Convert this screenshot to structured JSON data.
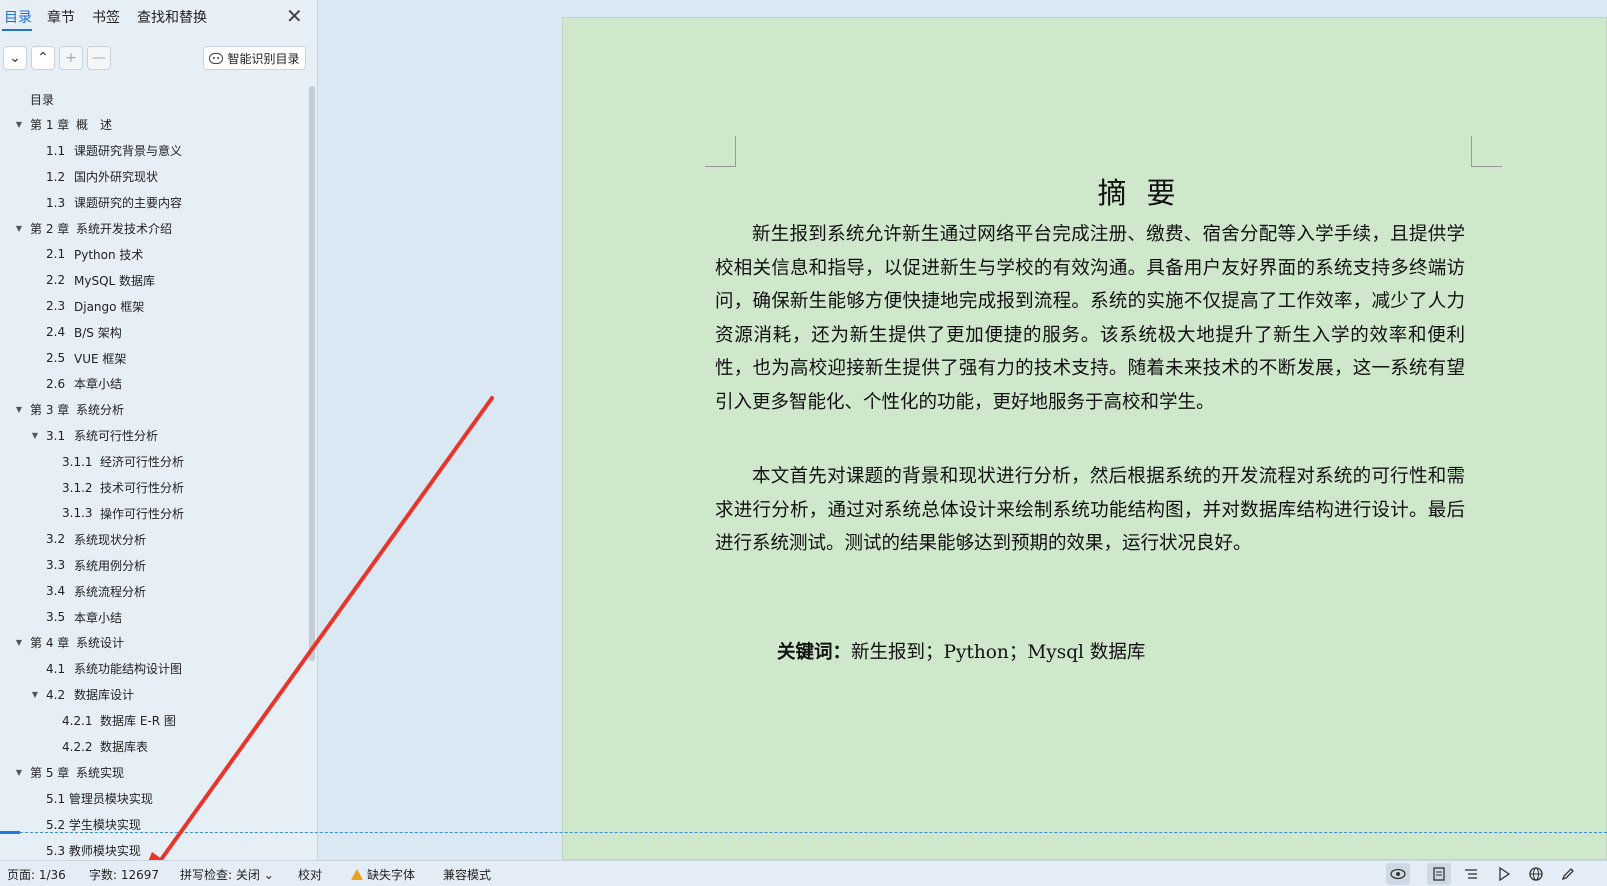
{
  "nav": {
    "tabs": [
      {
        "label": "目录",
        "active": true
      },
      {
        "label": "章节"
      },
      {
        "label": "书签"
      },
      {
        "label": "查找和替换"
      }
    ],
    "close_glyph": "✕",
    "tools": {
      "expand_glyph": "⌄",
      "collapse_glyph": "⌃",
      "add_glyph": "+",
      "remove_glyph": "—",
      "smart_label": "智能识别目录"
    },
    "toc": [
      {
        "num": "",
        "label": "目录",
        "level": 0,
        "arrow": ""
      },
      {
        "num": "第 1 章",
        "label": "概　述",
        "level": 0,
        "arrow": "▼"
      },
      {
        "num": "1.1",
        "label": "课题研究背景与意义",
        "level": 1,
        "arrow": ""
      },
      {
        "num": "1.2",
        "label": "国内外研究现状",
        "level": 1,
        "arrow": ""
      },
      {
        "num": "1.3",
        "label": "课题研究的主要内容",
        "level": 1,
        "arrow": ""
      },
      {
        "num": "第 2 章",
        "label": "系统开发技术介绍",
        "level": 0,
        "arrow": "▼"
      },
      {
        "num": "2.1",
        "label": "Python 技术",
        "level": 1,
        "arrow": ""
      },
      {
        "num": "2.2",
        "label": "MySQL 数据库",
        "level": 1,
        "arrow": ""
      },
      {
        "num": "2.3",
        "label": "Django 框架",
        "level": 1,
        "arrow": ""
      },
      {
        "num": "2.4",
        "label": "B/S 架构",
        "level": 1,
        "arrow": ""
      },
      {
        "num": "2.5",
        "label": "VUE 框架",
        "level": 1,
        "arrow": ""
      },
      {
        "num": "2.6",
        "label": "本章小结",
        "level": 1,
        "arrow": ""
      },
      {
        "num": "第 3 章",
        "label": "系统分析",
        "level": 0,
        "arrow": "▼"
      },
      {
        "num": "3.1",
        "label": "系统可行性分析",
        "level": 1,
        "arrow": "▼"
      },
      {
        "num": "3.1.1",
        "label": "经济可行性分析",
        "level": 2,
        "arrow": ""
      },
      {
        "num": "3.1.2",
        "label": "技术可行性分析",
        "level": 2,
        "arrow": ""
      },
      {
        "num": "3.1.3",
        "label": "操作可行性分析",
        "level": 2,
        "arrow": ""
      },
      {
        "num": "3.2",
        "label": "系统现状分析",
        "level": 1,
        "arrow": ""
      },
      {
        "num": "3.3",
        "label": "系统用例分析",
        "level": 1,
        "arrow": ""
      },
      {
        "num": "3.4",
        "label": "系统流程分析",
        "level": 1,
        "arrow": ""
      },
      {
        "num": "3.5",
        "label": "本章小结",
        "level": 1,
        "arrow": ""
      },
      {
        "num": "第 4 章",
        "label": "系统设计",
        "level": 0,
        "arrow": "▼"
      },
      {
        "num": "4.1",
        "label": "系统功能结构设计图",
        "level": 1,
        "arrow": ""
      },
      {
        "num": "4.2",
        "label": "数据库设计",
        "level": 1,
        "arrow": "▼"
      },
      {
        "num": "4.2.1",
        "label": "数据库 E-R 图",
        "level": 2,
        "arrow": ""
      },
      {
        "num": "4.2.2",
        "label": "数据库表",
        "level": 2,
        "arrow": ""
      },
      {
        "num": "第 5 章",
        "label": "系统实现",
        "level": 0,
        "arrow": "▼"
      },
      {
        "num": "",
        "label": "5.1 管理员模块实现",
        "level": 1,
        "arrow": ""
      },
      {
        "num": "",
        "label": "5.2 学生模块实现",
        "level": 1,
        "arrow": ""
      },
      {
        "num": "",
        "label": "5.3 教师模块实现",
        "level": 1,
        "arrow": ""
      }
    ]
  },
  "document": {
    "title": "摘要",
    "para1": "新生报到系统允许新生通过网络平台完成注册、缴费、宿舍分配等入学手续，且提供学校相关信息和指导，以促进新生与学校的有效沟通。具备用户友好界面的系统支持多终端访问，确保新生能够方便快捷地完成报到流程。系统的实施不仅提高了工作效率，减少了人力资源消耗，还为新生提供了更加便捷的服务。该系统极大地提升了新生入学的效率和便利性，也为高校迎接新生提供了强有力的技术支持。随着未来技术的不断发展，这一系统有望引入更多智能化、个性化的功能，更好地服务于高校和学生。",
    "para2": "本文首先对课题的背景和现状进行分析，然后根据系统的开发流程对系统的可行性和需求进行分析，通过对系统总体设计来绘制系统功能结构图，并对数据库结构进行设计。最后进行系统测试。测试的结果能够达到预期的效果，运行状况良好。",
    "keywords_label": "关键词：",
    "keywords": "新生报到；Python；Mysql 数据库"
  },
  "annotation": {
    "color": "#e8342a"
  },
  "status": {
    "page": "页面: 1/36",
    "word_count": "字数: 12697",
    "spell_check": "拼写检查: 关闭",
    "spell_dropdown": "⌄",
    "proofread": "校对",
    "missing_font": "缺失字体",
    "compat_mode": "兼容模式",
    "icons": [
      "eye-icon",
      "page-view-icon",
      "outline-view-icon",
      "play-icon",
      "globe-icon",
      "pen-icon"
    ]
  }
}
